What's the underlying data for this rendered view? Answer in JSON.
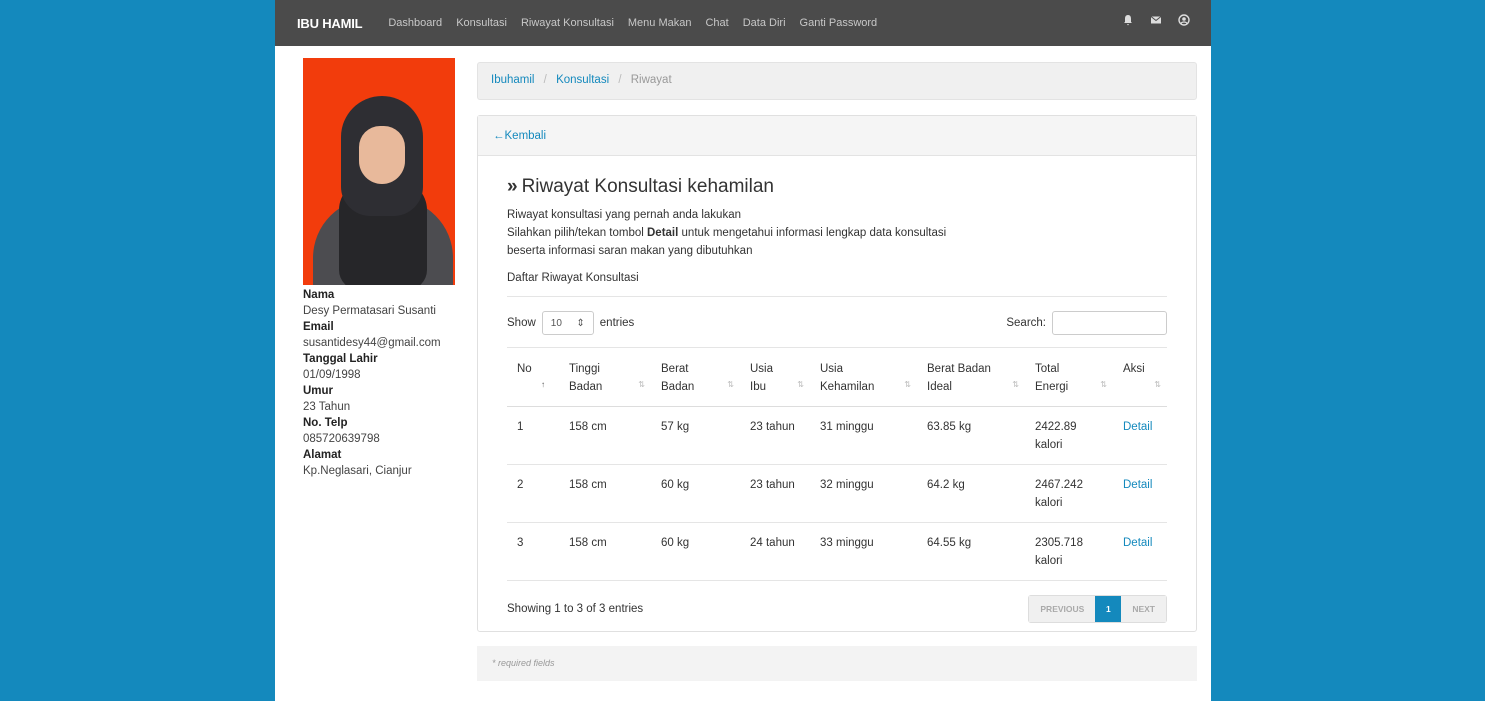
{
  "navbar": {
    "brand": "IBU HAMIL",
    "links": [
      "Dashboard",
      "Konsultasi",
      "Riwayat Konsultasi",
      "Menu Makan",
      "Chat",
      "Data Diri",
      "Ganti Password"
    ],
    "icons": [
      "bell-icon",
      "envelope-icon",
      "user-icon"
    ]
  },
  "profile": {
    "nama_label": "Nama",
    "nama": "Desy Permatasari Susanti",
    "email_label": "Email",
    "email": "susantidesy44@gmail.com",
    "tanggal_label": "Tanggal Lahir",
    "tanggal": "01/09/1998",
    "umur_label": "Umur",
    "umur": "23 Tahun",
    "telp_label": "No. Telp",
    "telp": "085720639798",
    "alamat_label": "Alamat",
    "alamat": "Kp.Neglasari, Cianjur"
  },
  "breadcrumb": [
    "Ibuhamil",
    "Konsultasi",
    "Riwayat"
  ],
  "panel": {
    "back": "Kembali",
    "title": "Riwayat Konsultasi kehamilan",
    "desc1": "Riwayat konsultasi yang pernah anda lakukan",
    "desc2_pre": "Silahkan pilih/tekan tombol ",
    "desc2_bold": "Detail",
    "desc2_post": " untuk mengetahui informasi lengkap data konsultasi",
    "desc3": "beserta informasi saran makan yang dibutuhkan",
    "subtitle": "Daftar Riwayat Konsultasi",
    "show_label": "Show",
    "show_value": "10",
    "entries_label": "entries",
    "search_label": "Search:",
    "search_value": ""
  },
  "table": {
    "headers": [
      [
        "No",
        ""
      ],
      [
        "Tinggi",
        "Badan"
      ],
      [
        "Berat",
        "Badan"
      ],
      [
        "Usia",
        "Ibu"
      ],
      [
        "Usia",
        "Kehamilan"
      ],
      [
        "Berat Badan",
        "Ideal"
      ],
      [
        "Total",
        "Energi"
      ],
      [
        "Aksi",
        ""
      ]
    ],
    "rows": [
      [
        "1",
        "158 cm",
        "57 kg",
        "23 tahun",
        "31 minggu",
        "63.85 kg",
        "2422.89",
        "kalori",
        "Detail"
      ],
      [
        "2",
        "158 cm",
        "60 kg",
        "23 tahun",
        "32 minggu",
        "64.2 kg",
        "2467.242",
        "kalori",
        "Detail"
      ],
      [
        "3",
        "158 cm",
        "60 kg",
        "24 tahun",
        "33 minggu",
        "64.55 kg",
        "2305.718",
        "kalori",
        "Detail"
      ]
    ]
  },
  "footer": {
    "info": "Showing 1 to 3 of 3 entries",
    "prev": "PREVIOUS",
    "page": "1",
    "next": "NEXT",
    "required": "* required fields"
  },
  "colors": {
    "background": "#1489bd",
    "navbar": "#4b4b4b",
    "accent": "#1489bd",
    "photo_bg": "#f23c0c"
  }
}
